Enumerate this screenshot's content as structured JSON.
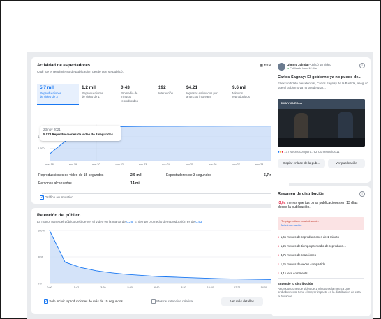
{
  "viewer": {
    "title": "Actividad de espectadores",
    "subtitle": "Cuál fue el rendimiento de publicación desde que se publicó.",
    "dropdown_label": "Total",
    "metrics": [
      {
        "value": "5,7 mil",
        "label": "Reproducciones de video de 3"
      },
      {
        "value": "1,2 mil",
        "label": "Reproducciones de video de 1"
      },
      {
        "value": "0:43",
        "label": "Promedio de minutos reproducidos"
      },
      {
        "value": "192",
        "label": "Interacción"
      },
      {
        "value": "$4,21",
        "label": "Ingresos estimados por anuncios instream"
      },
      {
        "value": "9,6 mil",
        "label": "Minutos reproducidos"
      }
    ],
    "tooltip_date": "23 nov 2021",
    "tooltip_text": "5.078 Reproducciones de video de 3 segundos",
    "stats": [
      {
        "label": "Reproducciones de video de 15 segundos",
        "value": "2,5 mil"
      },
      {
        "label": "Espectadores de 3 segundos",
        "value": "5,7 mil"
      },
      {
        "label": "Personas alcanzadas",
        "value": "14 mil"
      }
    ],
    "cumulative_label": "Gráfico acumulativo"
  },
  "chart_data": [
    {
      "type": "area",
      "x": [
        "nov 18",
        "nov 19",
        "nov 20",
        "nov 22",
        "nov 23",
        "nov 24",
        "nov 25",
        "nov 26",
        "nov 27",
        "nov 28",
        "dic 1"
      ],
      "values": [
        1100,
        4200,
        5078,
        5600,
        5650,
        5660,
        5670,
        5680,
        5690,
        5695,
        5700
      ],
      "yticks": [
        "4.000",
        "2.000"
      ],
      "ylim": [
        0,
        6000
      ],
      "grid": true
    },
    {
      "type": "area",
      "x": [
        "0:00",
        "1:40",
        "3:20",
        "5:00",
        "6:40",
        "8:20",
        "10:00",
        "11:40",
        "13:20",
        "15:00",
        "16:40",
        "18:20",
        "20:00",
        "21:40",
        "23:20",
        "25:00"
      ],
      "xticks": [
        "0:00",
        "1:42",
        "3:20",
        "5:00",
        "6:40",
        "8:20",
        "10:10",
        "12:21",
        "14:00"
      ],
      "values": [
        100,
        40,
        30,
        24,
        20,
        17,
        15,
        13,
        12,
        11,
        10,
        9,
        8.5,
        8,
        7.5,
        7
      ],
      "yticks": [
        "100%",
        "50%",
        "0%"
      ],
      "ylim": [
        0,
        100
      ],
      "grid": true
    }
  ],
  "retention": {
    "title": "Retención del público",
    "subtitle_pre": "La mayor parte del público dejó de ver el video en la marca de",
    "mark": "0:26",
    "subtitle_mid": ". El tiempo promedio de reproducción es de",
    "avg": "0:43",
    "include_label": "Solo incluir reproducciones de más de 15 segundos",
    "relative_label": "Mostrar retención relativa",
    "more_button": "Ver más detalles"
  },
  "post": {
    "author": "Jimmy Jairala",
    "author_suffix": "Publicó un video",
    "meta": "Publicado hace 12 días",
    "headline": "Carlos Sagnay: El gobierno ya no puede de...",
    "excerpt": "El excandidato presidencial, Carlos Sagnay de la Bastida, aseguró que el gobierno ya no puede usar...",
    "thumb_caption": "JIMMY JAIRALA",
    "reactions_count": "177",
    "shares_text": "Veces compart... 92",
    "comments_text": "Comentarios 11",
    "copy_button": "Copiar enlace de la pub...",
    "view_button": "Ver publicación"
  },
  "distribution": {
    "title": "Resumen de distribución",
    "headline_bold": "-3,0x",
    "headline_rest": "menos que tus otras publicaciones en 13 días desde la publicación.",
    "alert": "Tu página tiene una infracción",
    "alert_link": "Más información",
    "items": [
      "1,6x menos de reproducciones de 1 minuto",
      "1,2x menos de tiempo promedio de reproducci...",
      "3,7x menos de reacciones",
      "1,2x menos de veces compartido",
      "9,1x less comments"
    ],
    "understand_title": "Entiende tu distribución",
    "understand_text": "Reproducciones de video de 1 minuto es la métrica que probablemente tiene el mayor impacto en la distribución de esta publicación."
  },
  "colors": {
    "accent": "#1877f2",
    "chart_fill": "#c9dcf8",
    "alert_bg": "#fbe3e4",
    "negative": "#e41e3f"
  }
}
